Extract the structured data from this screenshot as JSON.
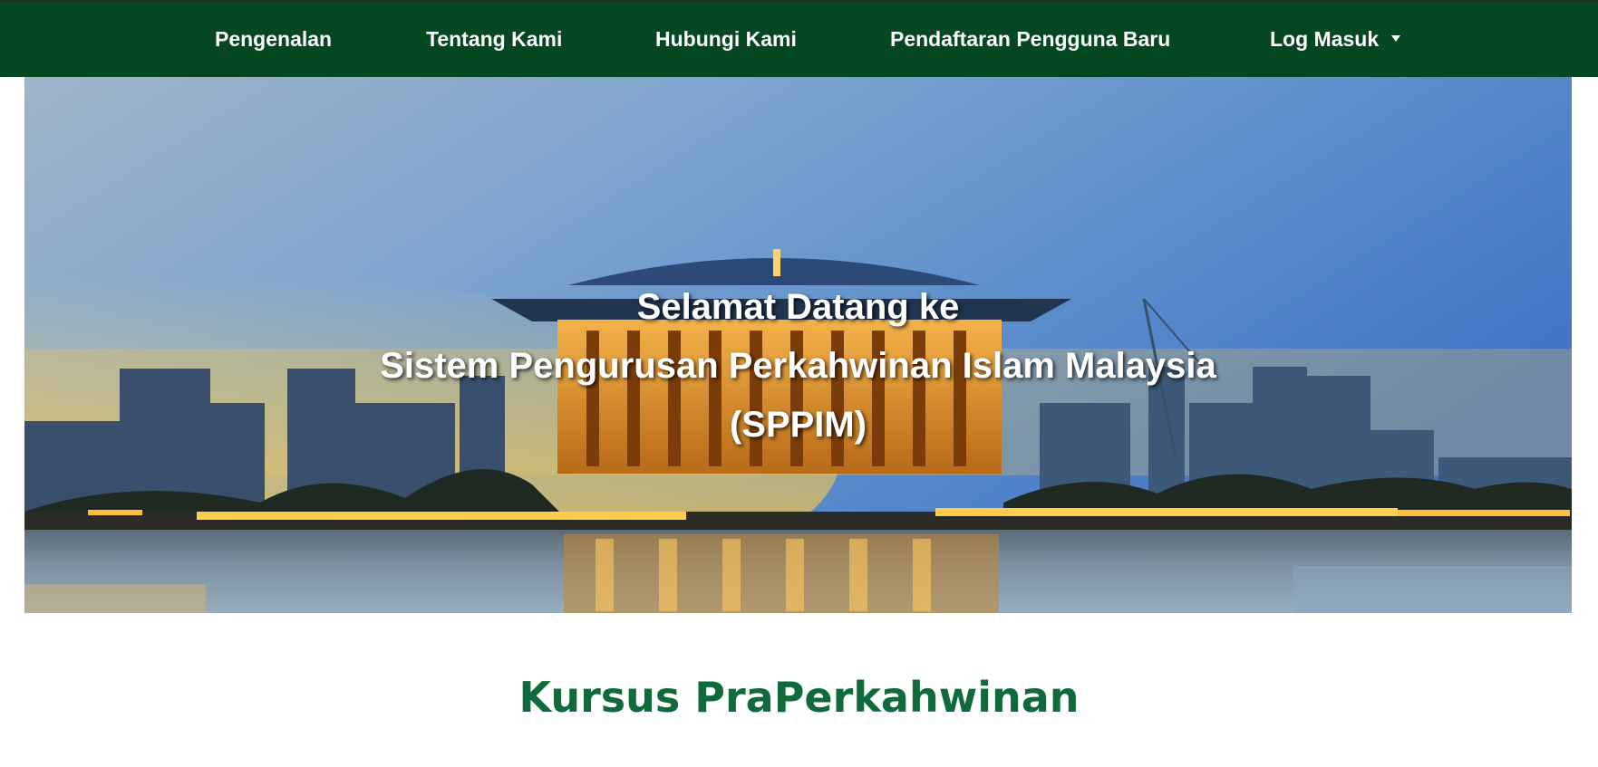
{
  "nav": {
    "items": [
      {
        "label": "Pengenalan"
      },
      {
        "label": "Tentang Kami"
      },
      {
        "label": "Hubungi Kami"
      },
      {
        "label": "Pendaftaran Pengguna Baru"
      },
      {
        "label": "Log Masuk"
      }
    ]
  },
  "hero": {
    "line1": "Selamat Datang ke",
    "line2": "Sistem Pengurusan Perkahwinan Islam Malaysia",
    "line3": "(SPPIM)"
  },
  "section": {
    "title": "Kursus PraPerkahwinan"
  },
  "colors": {
    "navbar": "#054720",
    "title": "#0f6b3b"
  },
  "icons": {
    "dropdown": "caret-down-icon"
  }
}
